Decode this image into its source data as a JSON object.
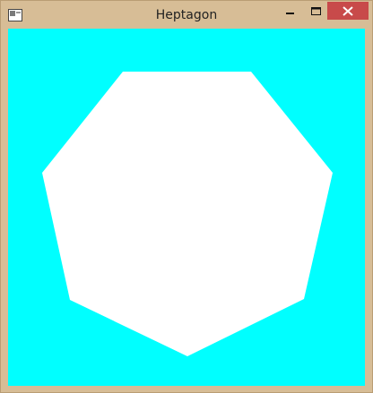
{
  "window": {
    "title": "Heptagon",
    "frame_color": "#d7bd96",
    "close_color": "#c84a4a"
  },
  "canvas": {
    "background": "#00ffff",
    "shape": "heptagon",
    "shape_fill": "#ffffff"
  },
  "icons": {
    "app": "app-icon",
    "minimize": "minimize-icon",
    "maximize": "maximize-icon",
    "close": "close-icon"
  }
}
